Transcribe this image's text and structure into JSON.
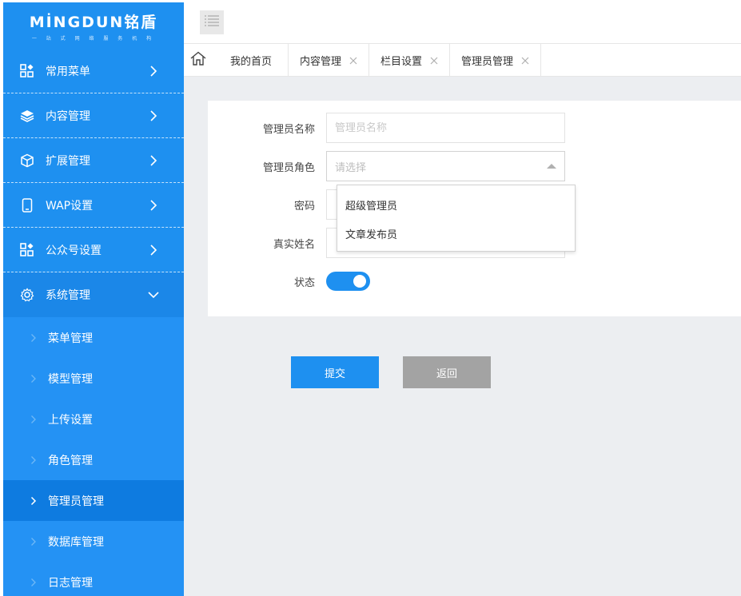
{
  "logo": {
    "name": "MİNGDUN铭盾",
    "tagline": "一 站 式 网 络 服 务 机 构"
  },
  "sidebar": {
    "items": [
      {
        "label": "常用菜单",
        "icon": "grid-apps-icon"
      },
      {
        "label": "内容管理",
        "icon": "layers-icon"
      },
      {
        "label": "扩展管理",
        "icon": "cube-icon"
      },
      {
        "label": "WAP设置",
        "icon": "mobile-icon"
      },
      {
        "label": "公众号设置",
        "icon": "grid-apps-icon"
      },
      {
        "label": "系统管理",
        "icon": "gear-icon"
      }
    ],
    "submenu": [
      {
        "label": "菜单管理"
      },
      {
        "label": "模型管理"
      },
      {
        "label": "上传设置"
      },
      {
        "label": "角色管理"
      },
      {
        "label": "管理员管理"
      },
      {
        "label": "数据库管理"
      },
      {
        "label": "日志管理"
      }
    ]
  },
  "tabs": {
    "home": "我的首页",
    "items": [
      {
        "label": "内容管理"
      },
      {
        "label": "栏目设置"
      },
      {
        "label": "管理员管理"
      }
    ]
  },
  "form": {
    "name_label": "管理员名称",
    "name_placeholder": "管理员名称",
    "role_label": "管理员角色",
    "role_placeholder": "请选择",
    "role_options": [
      "超级管理员",
      "文章发布员"
    ],
    "password_label": "密码",
    "realname_label": "真实姓名",
    "status_label": "状态",
    "status_on": true
  },
  "buttons": {
    "submit": "提交",
    "back": "返回"
  },
  "colors": {
    "primary": "#1e90f0",
    "sidebar": "#1e90f0",
    "active": "#0e7be0",
    "back_button": "#a3a3a3"
  }
}
